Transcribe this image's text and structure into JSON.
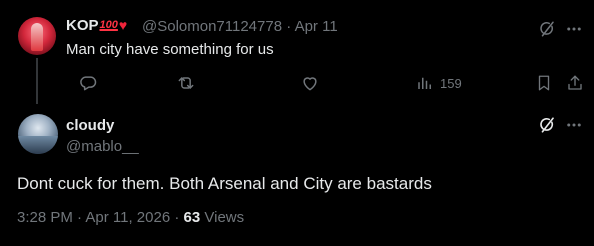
{
  "reply_tweet": {
    "display_name": "KOP",
    "name_emoji_100": "100",
    "name_emoji_heart": "♥",
    "handle": "@Solomon71124778",
    "separator": "·",
    "date": "Apr 11",
    "text": "Man city have something for us",
    "views_count": "159"
  },
  "main_tweet": {
    "display_name": "cloudy",
    "handle": "@mablo__",
    "text": "Dont cuck for them. Both Arsenal and City are bastards",
    "time": "3:28 PM",
    "separator": "·",
    "date": "Apr 11, 2026",
    "separator2": "·",
    "views_count": "63",
    "views_label": "Views"
  },
  "icons": {
    "more": "more-icon",
    "grok": "grok-icon",
    "reply": "reply-icon",
    "retweet": "retweet-icon",
    "like": "like-icon",
    "views": "views-icon",
    "bookmark": "bookmark-icon",
    "share": "share-icon"
  },
  "colors": {
    "background": "#000000",
    "primary_text": "#e7e9ea",
    "secondary_text": "#71767b",
    "heart_red": "#f0243a"
  }
}
